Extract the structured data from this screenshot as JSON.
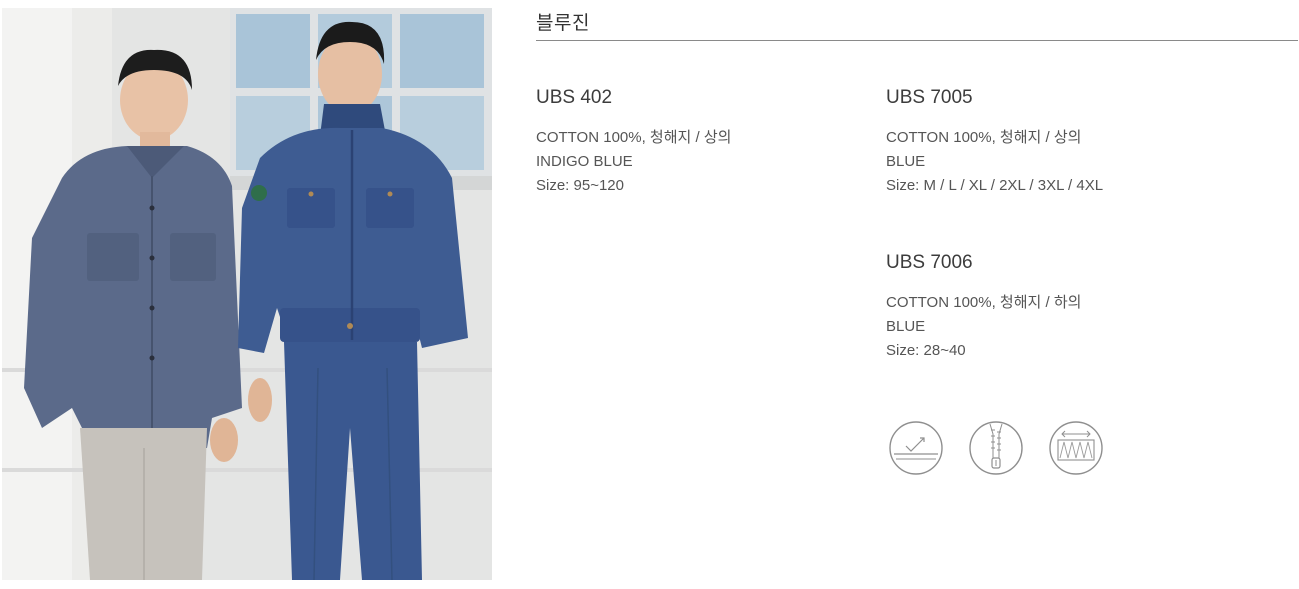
{
  "section": {
    "title": "블루진"
  },
  "products": [
    {
      "code": "UBS 402",
      "material": "COTTON 100%, 청해지 / 상의",
      "color": "INDIGO BLUE",
      "size": "Size: 95~120"
    },
    {
      "code": "UBS 7005",
      "material": "COTTON 100%, 청해지 / 상의",
      "color": "BLUE",
      "size": "Size: M / L / XL / 2XL / 3XL / 4XL"
    },
    {
      "code": "UBS 7006",
      "material": "COTTON 100%, 청해지 / 하의",
      "color": "BLUE",
      "size": "Size: 28~40"
    }
  ],
  "feature_icons": [
    "fabric-care-icon",
    "zipper-icon",
    "stretch-fabric-icon"
  ],
  "colors": {
    "indigo": "#4a5a7a",
    "denim": "#3f5a8a",
    "rule": "#8a8a8a"
  }
}
